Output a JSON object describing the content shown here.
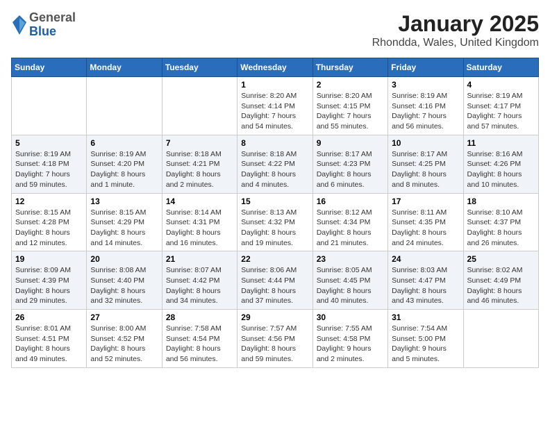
{
  "header": {
    "logo": {
      "general": "General",
      "blue": "Blue"
    },
    "title": "January 2025",
    "subtitle": "Rhondda, Wales, United Kingdom"
  },
  "weekdays": [
    "Sunday",
    "Monday",
    "Tuesday",
    "Wednesday",
    "Thursday",
    "Friday",
    "Saturday"
  ],
  "weeks": [
    [
      {
        "day": "",
        "info": ""
      },
      {
        "day": "",
        "info": ""
      },
      {
        "day": "",
        "info": ""
      },
      {
        "day": "1",
        "info": "Sunrise: 8:20 AM\nSunset: 4:14 PM\nDaylight: 7 hours\nand 54 minutes."
      },
      {
        "day": "2",
        "info": "Sunrise: 8:20 AM\nSunset: 4:15 PM\nDaylight: 7 hours\nand 55 minutes."
      },
      {
        "day": "3",
        "info": "Sunrise: 8:19 AM\nSunset: 4:16 PM\nDaylight: 7 hours\nand 56 minutes."
      },
      {
        "day": "4",
        "info": "Sunrise: 8:19 AM\nSunset: 4:17 PM\nDaylight: 7 hours\nand 57 minutes."
      }
    ],
    [
      {
        "day": "5",
        "info": "Sunrise: 8:19 AM\nSunset: 4:18 PM\nDaylight: 7 hours\nand 59 minutes."
      },
      {
        "day": "6",
        "info": "Sunrise: 8:19 AM\nSunset: 4:20 PM\nDaylight: 8 hours\nand 1 minute."
      },
      {
        "day": "7",
        "info": "Sunrise: 8:18 AM\nSunset: 4:21 PM\nDaylight: 8 hours\nand 2 minutes."
      },
      {
        "day": "8",
        "info": "Sunrise: 8:18 AM\nSunset: 4:22 PM\nDaylight: 8 hours\nand 4 minutes."
      },
      {
        "day": "9",
        "info": "Sunrise: 8:17 AM\nSunset: 4:23 PM\nDaylight: 8 hours\nand 6 minutes."
      },
      {
        "day": "10",
        "info": "Sunrise: 8:17 AM\nSunset: 4:25 PM\nDaylight: 8 hours\nand 8 minutes."
      },
      {
        "day": "11",
        "info": "Sunrise: 8:16 AM\nSunset: 4:26 PM\nDaylight: 8 hours\nand 10 minutes."
      }
    ],
    [
      {
        "day": "12",
        "info": "Sunrise: 8:15 AM\nSunset: 4:28 PM\nDaylight: 8 hours\nand 12 minutes."
      },
      {
        "day": "13",
        "info": "Sunrise: 8:15 AM\nSunset: 4:29 PM\nDaylight: 8 hours\nand 14 minutes."
      },
      {
        "day": "14",
        "info": "Sunrise: 8:14 AM\nSunset: 4:31 PM\nDaylight: 8 hours\nand 16 minutes."
      },
      {
        "day": "15",
        "info": "Sunrise: 8:13 AM\nSunset: 4:32 PM\nDaylight: 8 hours\nand 19 minutes."
      },
      {
        "day": "16",
        "info": "Sunrise: 8:12 AM\nSunset: 4:34 PM\nDaylight: 8 hours\nand 21 minutes."
      },
      {
        "day": "17",
        "info": "Sunrise: 8:11 AM\nSunset: 4:35 PM\nDaylight: 8 hours\nand 24 minutes."
      },
      {
        "day": "18",
        "info": "Sunrise: 8:10 AM\nSunset: 4:37 PM\nDaylight: 8 hours\nand 26 minutes."
      }
    ],
    [
      {
        "day": "19",
        "info": "Sunrise: 8:09 AM\nSunset: 4:39 PM\nDaylight: 8 hours\nand 29 minutes."
      },
      {
        "day": "20",
        "info": "Sunrise: 8:08 AM\nSunset: 4:40 PM\nDaylight: 8 hours\nand 32 minutes."
      },
      {
        "day": "21",
        "info": "Sunrise: 8:07 AM\nSunset: 4:42 PM\nDaylight: 8 hours\nand 34 minutes."
      },
      {
        "day": "22",
        "info": "Sunrise: 8:06 AM\nSunset: 4:44 PM\nDaylight: 8 hours\nand 37 minutes."
      },
      {
        "day": "23",
        "info": "Sunrise: 8:05 AM\nSunset: 4:45 PM\nDaylight: 8 hours\nand 40 minutes."
      },
      {
        "day": "24",
        "info": "Sunrise: 8:03 AM\nSunset: 4:47 PM\nDaylight: 8 hours\nand 43 minutes."
      },
      {
        "day": "25",
        "info": "Sunrise: 8:02 AM\nSunset: 4:49 PM\nDaylight: 8 hours\nand 46 minutes."
      }
    ],
    [
      {
        "day": "26",
        "info": "Sunrise: 8:01 AM\nSunset: 4:51 PM\nDaylight: 8 hours\nand 49 minutes."
      },
      {
        "day": "27",
        "info": "Sunrise: 8:00 AM\nSunset: 4:52 PM\nDaylight: 8 hours\nand 52 minutes."
      },
      {
        "day": "28",
        "info": "Sunrise: 7:58 AM\nSunset: 4:54 PM\nDaylight: 8 hours\nand 56 minutes."
      },
      {
        "day": "29",
        "info": "Sunrise: 7:57 AM\nSunset: 4:56 PM\nDaylight: 8 hours\nand 59 minutes."
      },
      {
        "day": "30",
        "info": "Sunrise: 7:55 AM\nSunset: 4:58 PM\nDaylight: 9 hours\nand 2 minutes."
      },
      {
        "day": "31",
        "info": "Sunrise: 7:54 AM\nSunset: 5:00 PM\nDaylight: 9 hours\nand 5 minutes."
      },
      {
        "day": "",
        "info": ""
      }
    ]
  ]
}
